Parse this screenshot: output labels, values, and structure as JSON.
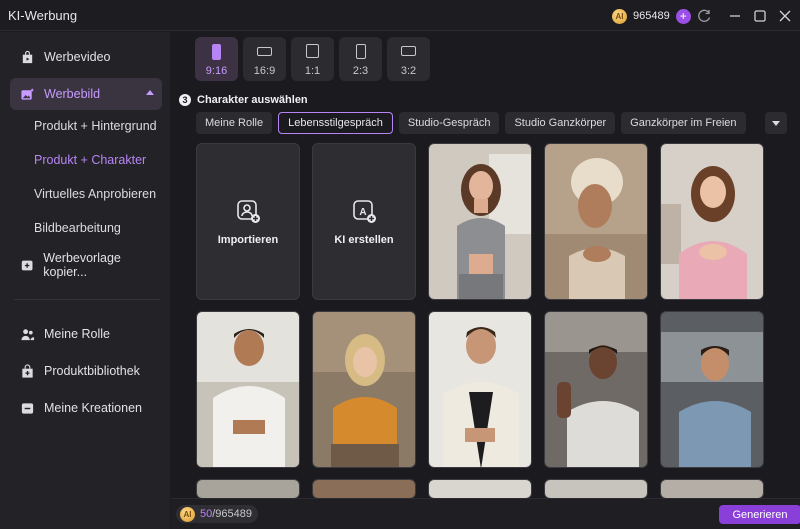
{
  "window": {
    "title": "KI-Werbung",
    "credits": "965489",
    "coin_glyph": "AI"
  },
  "sidebar": {
    "items": [
      {
        "label": "Werbevideo",
        "icon": "video-bag-icon"
      },
      {
        "label": "Werbebild",
        "icon": "image-sparkle-icon"
      },
      {
        "label": "Werbevorlage kopier...",
        "icon": "template-plus-icon"
      },
      {
        "label": "Meine Rolle",
        "icon": "people-icon"
      },
      {
        "label": "Produktbibliothek",
        "icon": "product-bag-icon"
      },
      {
        "label": "Meine Kreationen",
        "icon": "creations-icon"
      }
    ],
    "subitems": [
      {
        "label": "Produkt + Hintergrund"
      },
      {
        "label": "Produkt + Charakter"
      },
      {
        "label": "Virtuelles Anprobieren"
      },
      {
        "label": "Bildbearbeitung"
      }
    ]
  },
  "ratios": [
    {
      "label": "9:16",
      "selected": true
    },
    {
      "label": "16:9",
      "selected": false
    },
    {
      "label": "1:1",
      "selected": false
    },
    {
      "label": "2:3",
      "selected": false
    },
    {
      "label": "3:2",
      "selected": false
    }
  ],
  "section": {
    "step": "3",
    "title": "Charakter auswählen"
  },
  "tabs": [
    {
      "label": "Meine Rolle"
    },
    {
      "label": "Lebensstilgespräch",
      "selected": true
    },
    {
      "label": "Studio-Gespräch"
    },
    {
      "label": "Studio Ganzkörper"
    },
    {
      "label": "Ganzkörper im Freien"
    }
  ],
  "actions": {
    "import_label": "Importieren",
    "create_label": "KI erstellen",
    "create_glyph": "A"
  },
  "footer": {
    "used": "50",
    "total": "/965489",
    "generate_label": "Generieren"
  },
  "colors": {
    "accent": "#b784f5",
    "button": "#8a3fd9",
    "active_bg": "#3a3340"
  }
}
